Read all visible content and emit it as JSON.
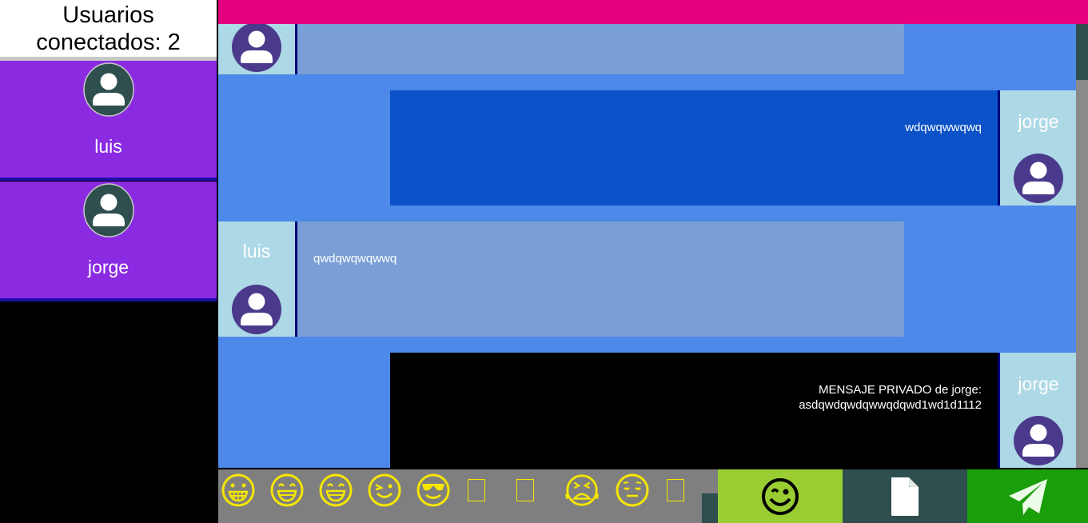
{
  "sidebar": {
    "header_line1": "Usuarios",
    "header_line2": "conectados: 2",
    "users": [
      {
        "name": "luis"
      },
      {
        "name": "jorge"
      }
    ]
  },
  "messages": [
    {
      "sender": "",
      "text": "",
      "side": "left"
    },
    {
      "sender": "jorge",
      "text": "wdqwqwwqwq",
      "side": "right"
    },
    {
      "sender": "luis",
      "text": "qwdqwqwqwwq",
      "side": "left"
    },
    {
      "sender": "jorge",
      "text_line1": "MENSAJE PRIVADO de jorge:",
      "text_line2": "asdqwdqwdqwwqdqwd1wd1d1112",
      "side": "right",
      "private": true
    }
  ],
  "emojis": [
    "grinning-face-icon",
    "grinning-face-smiling-eyes-icon",
    "beaming-face-icon",
    "winking-face-icon",
    "smiling-face-sunglasses-icon",
    "missing-glyph-icon",
    "missing-glyph-icon",
    "tired-face-icon",
    "relieved-face-icon",
    "missing-glyph-icon"
  ],
  "colors": {
    "sidebar_card": "#8a2be2",
    "topbar": "#e4007e",
    "chat_bg": "#4c89e8",
    "bubble_left": "#7a9fd6",
    "bubble_right": "#0b52c8",
    "bubble_private": "#000000",
    "avatar_block": "#add8e6",
    "avatar_circle": "#4b3a8c",
    "emoji_button": "#9acd32",
    "file_button": "#2f4f4f",
    "send_button": "#1a9e0a",
    "emoji_color": "#f5e600"
  }
}
